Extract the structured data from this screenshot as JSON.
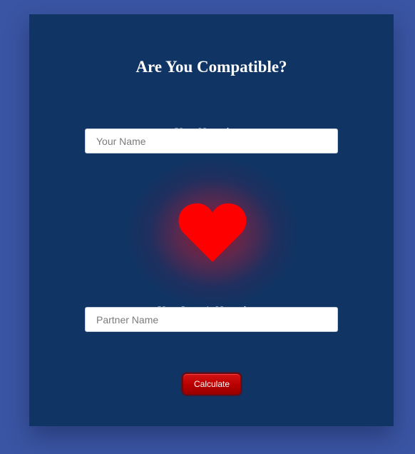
{
  "form": {
    "title": "Are You Compatible?",
    "name_label": "Your Name here:",
    "name_placeholder": "Your Name",
    "name_value": "",
    "partner_label": "Your Lover's Name here:",
    "partner_placeholder": "Partner Name",
    "partner_value": "",
    "calculate_label": "Calculate"
  },
  "icons": {
    "heart": "heart-icon"
  },
  "colors": {
    "page_background": "#3a55a3",
    "card_background": "#103463",
    "heart": "#ff0000",
    "button": "#b80000",
    "text": "#ffffff"
  }
}
